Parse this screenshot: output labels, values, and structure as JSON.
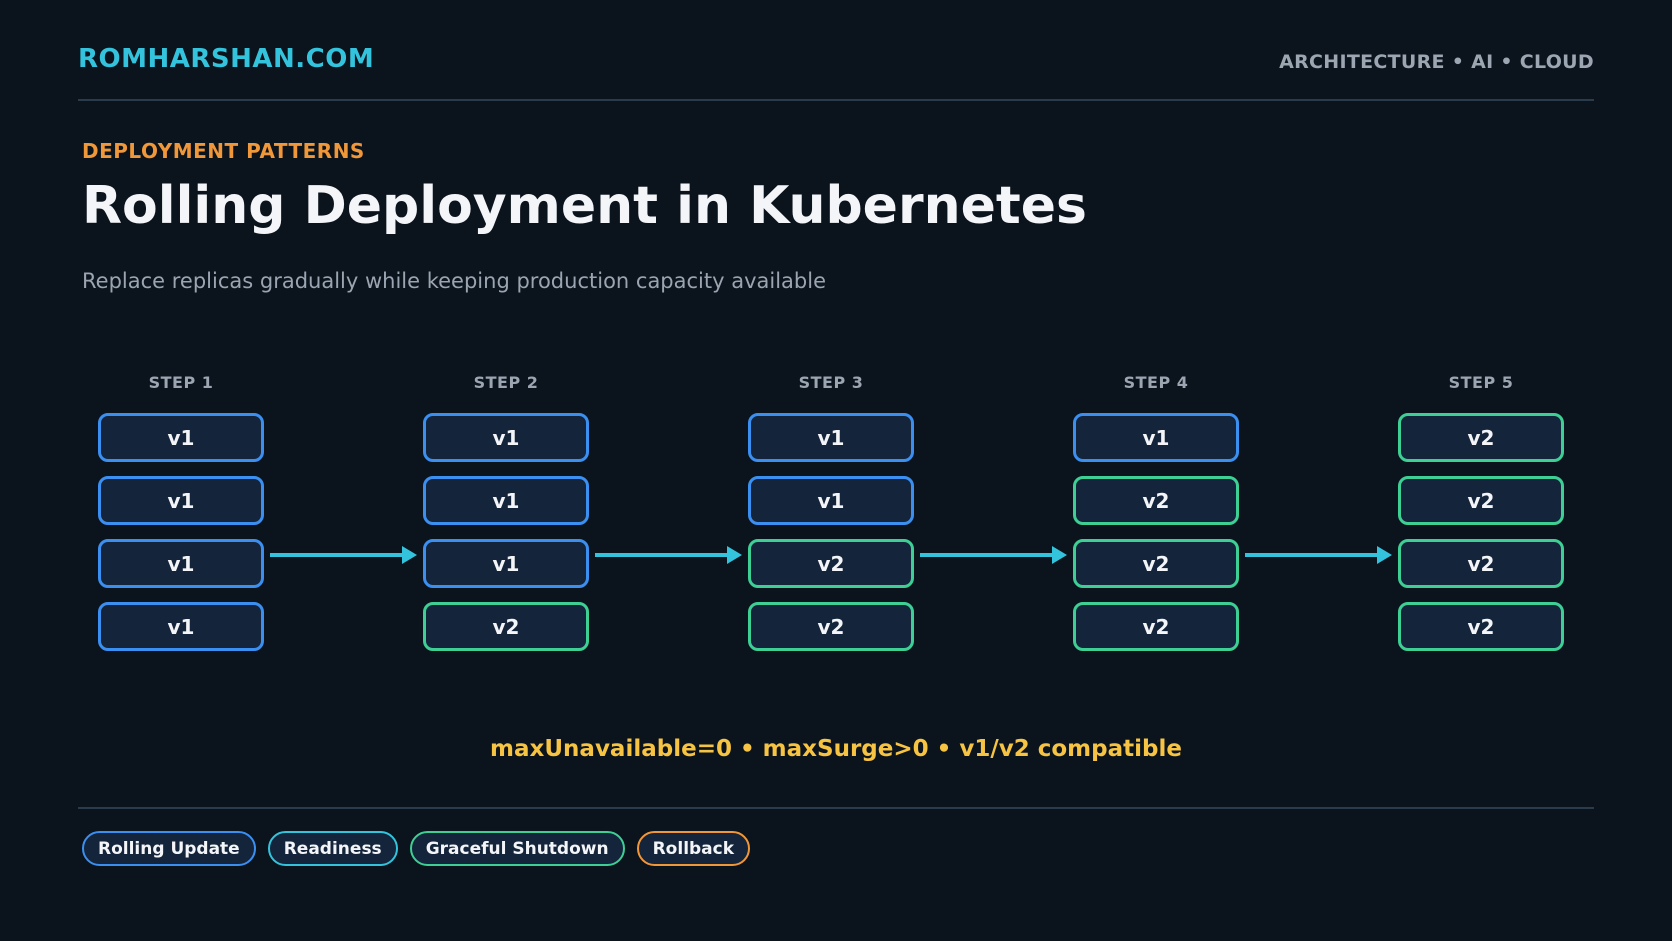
{
  "header": {
    "brand": "ROMHARSHAN.COM",
    "topics": "ARCHITECTURE • AI • CLOUD"
  },
  "intro": {
    "eyebrow": "DEPLOYMENT PATTERNS",
    "title": "Rolling Deployment in Kubernetes",
    "subtitle": "Replace replicas gradually while keeping production capacity available"
  },
  "steps": [
    {
      "label": "STEP 1",
      "pods": [
        "v1",
        "v1",
        "v1",
        "v1"
      ]
    },
    {
      "label": "STEP 2",
      "pods": [
        "v1",
        "v1",
        "v1",
        "v2"
      ]
    },
    {
      "label": "STEP 3",
      "pods": [
        "v1",
        "v1",
        "v2",
        "v2"
      ]
    },
    {
      "label": "STEP 4",
      "pods": [
        "v1",
        "v2",
        "v2",
        "v2"
      ]
    },
    {
      "label": "STEP 5",
      "pods": [
        "v2",
        "v2",
        "v2",
        "v2"
      ]
    }
  ],
  "constraints": "maxUnavailable=0 • maxSurge>0 • v1/v2 compatible",
  "tags": [
    {
      "label": "Rolling Update",
      "color": "#3b8ff0"
    },
    {
      "label": "Readiness",
      "color": "#34c3dc"
    },
    {
      "label": "Graceful Shutdown",
      "color": "#3ecf95"
    },
    {
      "label": "Rollback",
      "color": "#f0973a"
    }
  ],
  "colors": {
    "v1": "#3b8ff0",
    "v2": "#3ecf95",
    "arrow": "#34c3dc",
    "accent": "#34c3dc",
    "eyebrow": "#f0973a",
    "constraints": "#f6c343"
  }
}
